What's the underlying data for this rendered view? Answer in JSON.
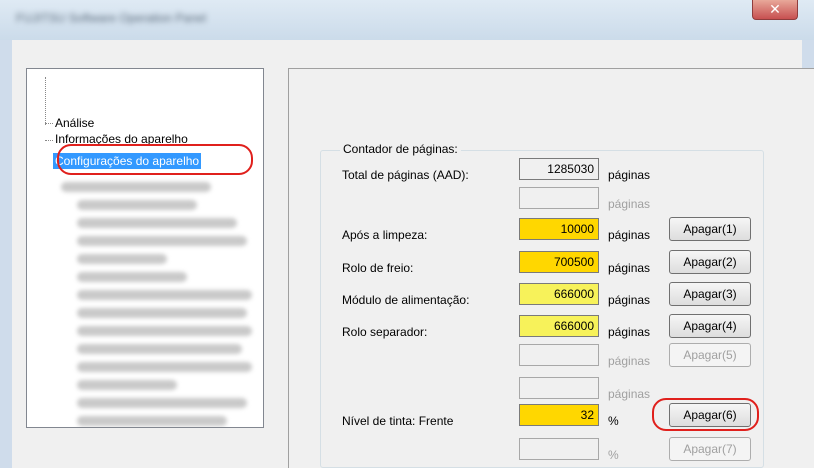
{
  "window": {
    "title": "FUJITSU Software Operation Panel",
    "close_glyph": "✕"
  },
  "tree": {
    "items": [
      {
        "label": "Análise"
      },
      {
        "label": "Informações do aparelho"
      },
      {
        "label": "Configurações do aparelho",
        "selected": true
      }
    ],
    "scroll_up_glyph": "▲",
    "thumb_grip": "≡"
  },
  "counter_group": {
    "title": "Contador de páginas:",
    "rows": [
      {
        "label": "Total de páginas (AAD):",
        "value": "1285030",
        "unit": "páginas",
        "button": "",
        "style": "plain"
      },
      {
        "label": "",
        "value": "",
        "unit": "páginas",
        "button": "",
        "style": "empty"
      },
      {
        "label": "Após a limpeza:",
        "value": "10000",
        "unit": "páginas",
        "button": "Apagar(1)",
        "style": "yellow"
      },
      {
        "label": "Rolo de freio:",
        "value": "700500",
        "unit": "páginas",
        "button": "Apagar(2)",
        "style": "yellow"
      },
      {
        "label": "Módulo de alimentação:",
        "value": "666000",
        "unit": "páginas",
        "button": "Apagar(3)",
        "style": "lightyellow"
      },
      {
        "label": "Rolo separador:",
        "value": "666000",
        "unit": "páginas",
        "button": "Apagar(4)",
        "style": "lightyellow"
      },
      {
        "label": "",
        "value": "",
        "unit": "páginas",
        "button": "Apagar(5)",
        "style": "empty"
      },
      {
        "label": "",
        "value": "",
        "unit": "páginas",
        "button": "",
        "style": "empty"
      },
      {
        "label": "Nível de tinta: Frente",
        "value": "32",
        "unit": "%",
        "button": "Apagar(6)",
        "style": "yellow"
      },
      {
        "label": "",
        "value": "",
        "unit": "%",
        "button": "Apagar(7)",
        "style": "empty"
      }
    ]
  },
  "colors": {
    "selection": "#3399ff",
    "annotation": "#e0201c",
    "highlight_yellow": "#ffd700",
    "highlight_light_yellow": "#f7f25a"
  }
}
